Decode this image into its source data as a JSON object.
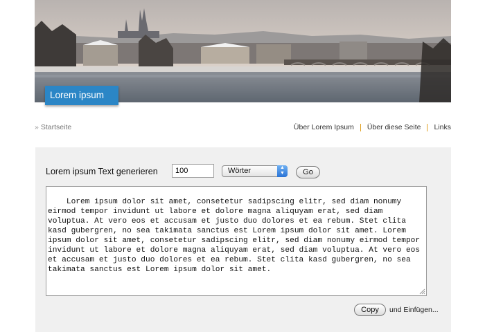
{
  "header": {
    "site_title": "Lorem ipsum"
  },
  "breadcrumb": {
    "home_label": "Startseite"
  },
  "topnav": {
    "items": [
      "Über Lorem Ipsum",
      "Über diese Seite",
      "Links"
    ]
  },
  "generator": {
    "label": "Lorem ipsum Text generieren",
    "count_value": "100",
    "unit_selected": "Wörter",
    "go_label": "Go",
    "output_text": "Lorem ipsum dolor sit amet, consetetur sadipscing elitr, sed diam nonumy eirmod tempor invidunt ut labore et dolore magna aliquyam erat, sed diam voluptua. At vero eos et accusam et justo duo dolores et ea rebum. Stet clita kasd gubergren, no sea takimata sanctus est Lorem ipsum dolor sit amet. Lorem ipsum dolor sit amet, consetetur sadipscing elitr, sed diam nonumy eirmod tempor invidunt ut labore et dolore magna aliquyam erat, sed diam voluptua. At vero eos et accusam et justo duo dolores et ea rebum. Stet clita kasd gubergren, no sea takimata sanctus est Lorem ipsum dolor sit amet.",
    "copy_label": "Copy",
    "paste_label": "und Einfügen..."
  },
  "colors": {
    "accent": "#2b86c6",
    "nav_separator": "#e0a020",
    "panel_bg": "#f0f0f0"
  }
}
